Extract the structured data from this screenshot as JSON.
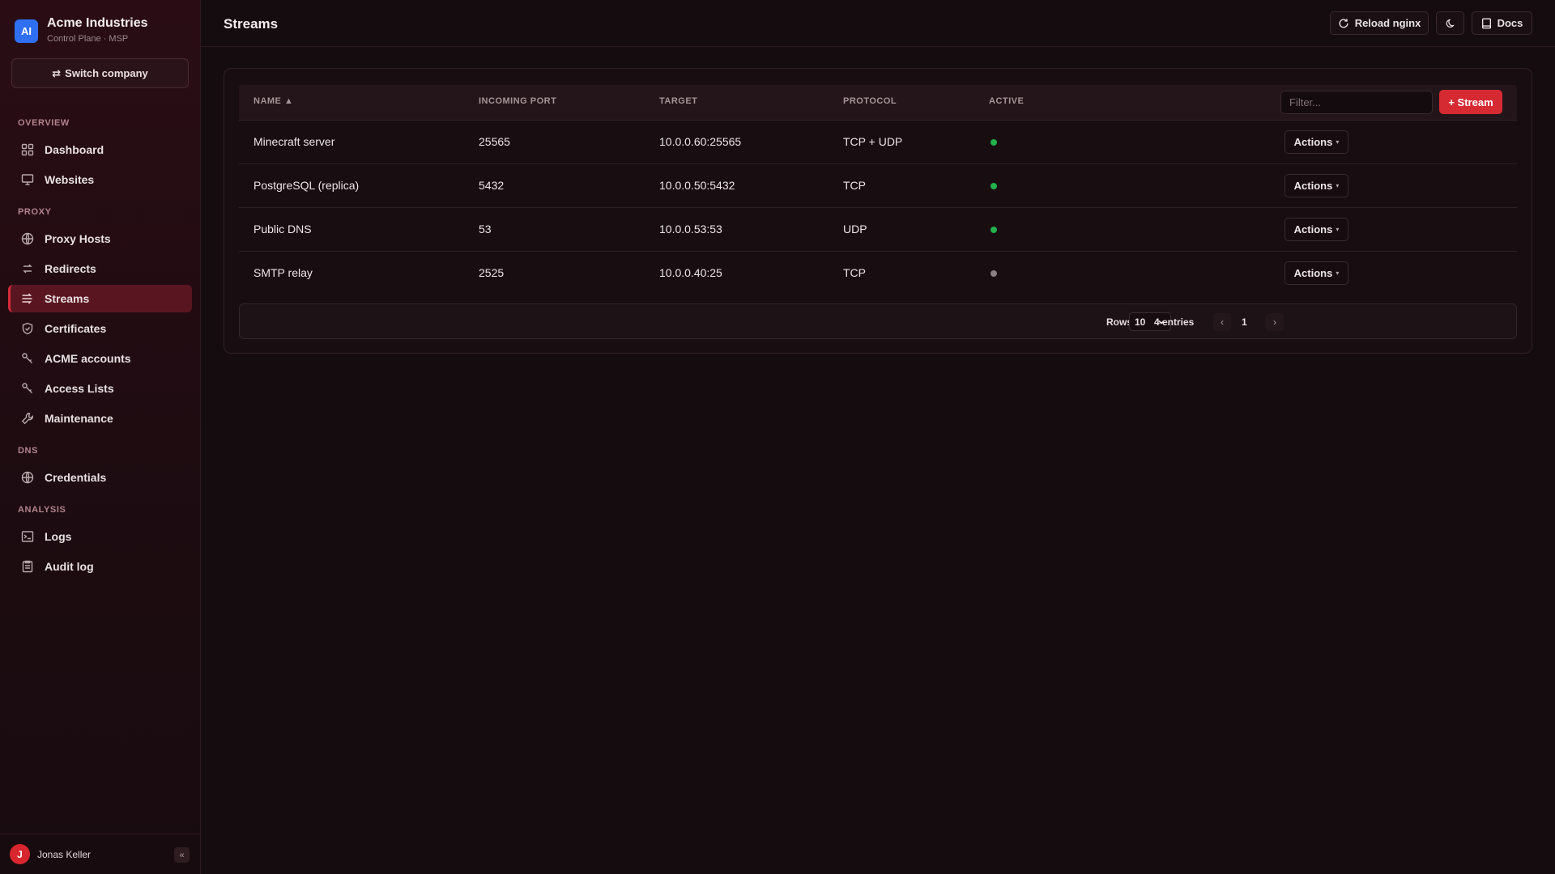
{
  "brand": {
    "logo_text": "AI",
    "name": "Acme Industries",
    "subtitle": "Control Plane · MSP"
  },
  "switch_company": {
    "icon": "swap-icon",
    "label": "Switch company"
  },
  "sidebar": {
    "sections": [
      {
        "label": "OVERVIEW"
      },
      {
        "label": "PROXY"
      },
      {
        "label": "DNS"
      },
      {
        "label": "ANALYSIS"
      }
    ],
    "items": [
      {
        "label": "Dashboard",
        "icon": "dashboard-icon"
      },
      {
        "label": "Websites",
        "icon": "monitor-icon"
      },
      {
        "label": "Proxy Hosts",
        "icon": "globe-icon"
      },
      {
        "label": "Redirects",
        "icon": "redirect-icon"
      },
      {
        "label": "Streams",
        "icon": "streams-icon",
        "active": true
      },
      {
        "label": "Certificates",
        "icon": "shield-icon"
      },
      {
        "label": "ACME accounts",
        "icon": "key-icon"
      },
      {
        "label": "Access Lists",
        "icon": "key-icon"
      },
      {
        "label": "Maintenance",
        "icon": "wrench-icon"
      },
      {
        "label": "Credentials",
        "icon": "globe-icon"
      },
      {
        "label": "Logs",
        "icon": "terminal-icon"
      },
      {
        "label": "Audit log",
        "icon": "clipboard-icon"
      }
    ]
  },
  "user": {
    "initial": "J",
    "name": "Jonas Keller",
    "collapse": "«"
  },
  "header": {
    "title": "Streams",
    "reload_label": "Reload nginx",
    "theme_icon": "moon-icon",
    "docs_label": "Docs"
  },
  "table": {
    "columns": [
      "NAME ▲",
      "INCOMING PORT",
      "TARGET",
      "PROTOCOL",
      "ACTIVE"
    ],
    "filter_placeholder": "Filter...",
    "add_label": "+ Stream",
    "actions_label": "Actions",
    "rows": [
      {
        "name": "Minecraft server",
        "port": "25565",
        "target": "10.0.0.60:25565",
        "protocol": "TCP + UDP",
        "active": true
      },
      {
        "name": "PostgreSQL (replica)",
        "port": "5432",
        "target": "10.0.0.50:5432",
        "protocol": "TCP",
        "active": true
      },
      {
        "name": "Public DNS",
        "port": "53",
        "target": "10.0.0.53:53",
        "protocol": "UDP",
        "active": true
      },
      {
        "name": "SMTP relay",
        "port": "2525",
        "target": "10.0.0.40:25",
        "protocol": "TCP",
        "active": false
      }
    ]
  },
  "pagination": {
    "rows_label": "Rows",
    "rows_value": "10",
    "entries": "4 entries",
    "prev": "‹",
    "page": "1",
    "next": "›"
  },
  "colors": {
    "accent": "#d62a33",
    "active_dot": "#22b14c",
    "inactive_dot": "#8a7e82",
    "sidebar_active": "#5a1620"
  }
}
